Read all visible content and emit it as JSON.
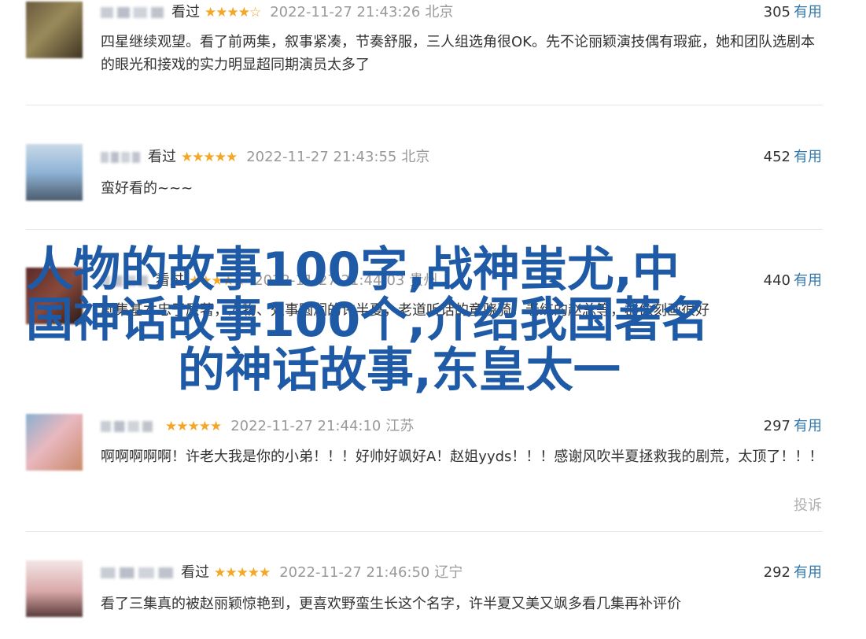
{
  "reviews": [
    {
      "watched": "看过",
      "stars": "★★★★☆",
      "time": "2022-11-27 21:43:26",
      "location": "北京",
      "useful_count": "305",
      "useful_label": "有用",
      "text": "四星继续观望。看了前两集，叙事紧凑，节奏舒服，三人组选角很OK。先不论丽颖演技偶有瑕疵，她和团队选剧本的眼光和接戏的实力明显超同期演员太多了",
      "avatar_colors": [
        "#6b5a3e",
        "#9a8a5a",
        "#3e3422"
      ]
    },
    {
      "watched": "看过",
      "stars": "★★★★★",
      "time": "2022-11-27 21:43:55",
      "location": "北京",
      "useful_count": "452",
      "useful_label": "有用",
      "text": "蛮好看的~~~",
      "avatar_colors": [
        "#8fb3d6",
        "#c9d9e8",
        "#4b5c6e"
      ]
    },
    {
      "watched": "看过",
      "stars": "★★★★★",
      "time": "2022-11-27 21:44:03",
      "location": "贵州",
      "useful_count": "440",
      "useful_label": "有用",
      "text": "剧集基本忠于原著，人物、处事圆润的许半夏，老道听话的童骁骑，老练的赵总等，群像刻画很好",
      "avatar_colors": [
        "#5b2a2a",
        "#8a4a3a",
        "#2a1a1a"
      ]
    },
    {
      "watched": "",
      "stars": "★★★★★",
      "time": "2022-11-27 21:44:10",
      "location": "江苏",
      "useful_count": "297",
      "useful_label": "有用",
      "text": "啊啊啊啊啊！许老大我是你的小弟！！！好帅好飒好A！赵姐yyds！！！感谢风吹半夏拯救我的剧荒，太顶了！！！",
      "report": "投诉",
      "avatar_colors": [
        "#e9b8c0",
        "#c98a6a",
        "#8ab0d0"
      ]
    },
    {
      "watched": "看过",
      "stars": "★★★★★",
      "time": "2022-11-27 21:46:50",
      "location": "辽宁",
      "useful_count": "292",
      "useful_label": "有用",
      "text": "看了三集真的被赵丽颖惊艳到，更喜欢野蛮生长这个名字，许半夏又美又飒多看几集再补评价",
      "avatar_colors": [
        "#f3e6e6",
        "#d9a8a8",
        "#5a3a3a"
      ]
    }
  ],
  "overlay_title": {
    "line1": "人物的故事100字,战神蚩尤,中",
    "line2": "国神话故事100个,介绍我国著名",
    "line3": "的神话故事,东皇太一"
  }
}
